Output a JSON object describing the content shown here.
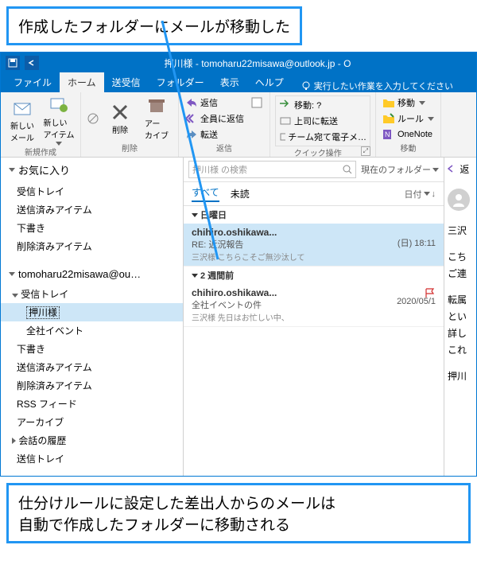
{
  "annotations": {
    "top": "作成したフォルダーにメールが移動した",
    "bottom": "仕分けルールに設定した差出人からのメールは\n自動で作成したフォルダーに移動される"
  },
  "titleBar": {
    "title": "押川様 - tomoharu22misawa@outlook.jp - O"
  },
  "ribbonTabs": {
    "file": "ファイル",
    "home": "ホーム",
    "sendReceive": "送受信",
    "folder": "フォルダー",
    "view": "表示",
    "help": "ヘルプ",
    "tellMe": "実行したい作業を入力してください"
  },
  "ribbon": {
    "newMail": "新しい\nメール",
    "newItem": "新しい\nアイテム",
    "groupNew": "新規作成",
    "delete": "削除",
    "archive": "アー\nカイブ",
    "groupDelete": "削除",
    "reply": "返信",
    "replyAll": "全員に返信",
    "forward": "転送",
    "groupRespond": "返信",
    "moveTo": "移動:  ?",
    "toManager": "上司に転送",
    "teamMail": "チーム宛て電子メ…",
    "groupQuick": "クイック操作",
    "move": "移動",
    "rules": "ルール",
    "oneNote": "OneNote",
    "groupMove": "移動"
  },
  "nav": {
    "favorites": "お気に入り",
    "inbox": "受信トレイ",
    "sent": "送信済みアイテム",
    "drafts": "下書き",
    "deleted": "削除済みアイテム",
    "account": "tomoharu22misawa@ou…",
    "oshikawa": "押川様",
    "allCompany": "全社イベント",
    "rss": "RSS フィード",
    "archiveFolder": "アーカイブ",
    "convHistory": "会話の履歴",
    "outbox": "送信トレイ"
  },
  "search": {
    "placeholder": "押川様 の検索",
    "scope": "現在のフォルダー"
  },
  "filters": {
    "all": "すべて",
    "unread": "未読",
    "sortBy": "日付"
  },
  "messages": {
    "group1": "日曜日",
    "group2": "2 週間前",
    "m1": {
      "from": "chihiro.oshikawa...",
      "subject": "RE: 近況報告",
      "preview": "三沢様  こちらこそご無沙汰して",
      "date": "(日) 18:11"
    },
    "m2": {
      "from": "chihiro.oshikawa...",
      "subject": "全社イベントの件",
      "preview": "三沢様  先日はお忙しい中、",
      "date": "2020/05/1"
    }
  },
  "reading": {
    "replyBtn": "返",
    "l1": "三沢",
    "l2": "こち",
    "l3": "ご連",
    "l4": "転属",
    "l5": "とい",
    "l6": "詳し",
    "l7": "これ",
    "l8": "押川"
  }
}
